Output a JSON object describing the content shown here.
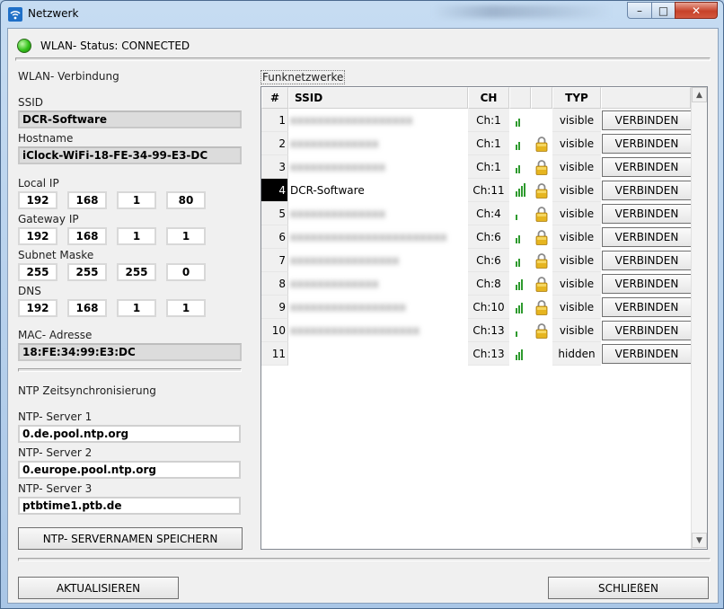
{
  "window": {
    "title": "Netzwerk",
    "background_text": ""
  },
  "status": {
    "text": "WLAN- Status: CONNECTED",
    "led_color": "#33c21a"
  },
  "wlan": {
    "header": "WLAN- Verbindung",
    "ssid_label": "SSID",
    "ssid_value": "DCR-Software",
    "hostname_label": "Hostname",
    "hostname_value": "iClock-WiFi-18-FE-34-99-E3-DC",
    "local_ip_label": "Local IP",
    "local_ip": [
      "192",
      "168",
      "1",
      "80"
    ],
    "gateway_label": "Gateway IP",
    "gateway_ip": [
      "192",
      "168",
      "1",
      "1"
    ],
    "subnet_label": "Subnet Maske",
    "subnet": [
      "255",
      "255",
      "255",
      "0"
    ],
    "dns_label": "DNS",
    "dns": [
      "192",
      "168",
      "1",
      "1"
    ],
    "mac_label": "MAC- Adresse",
    "mac_value": "18:FE:34:99:E3:DC"
  },
  "ntp": {
    "header": "NTP Zeitsynchronisierung",
    "server1_label": "NTP- Server 1",
    "server1_value": "0.de.pool.ntp.org",
    "server2_label": "NTP- Server 2",
    "server2_value": "0.europe.pool.ntp.org",
    "server3_label": "NTP- Server 3",
    "server3_value": "ptbtime1.ptb.de",
    "save_label": "NTP- SERVERNAMEN SPEICHERN"
  },
  "networks": {
    "group_label": "Funknetzwerke",
    "columns": {
      "num": "#",
      "ssid": "SSID",
      "ch": "CH",
      "typ": "TYP"
    },
    "connect_label": "VERBINDEN",
    "rows": [
      {
        "num": "1",
        "ssid": "xxxxxxxxxxxxxxxxxx",
        "blurred": true,
        "ch": "Ch:1",
        "signal": 2,
        "locked": false,
        "typ": "visible",
        "selected": false
      },
      {
        "num": "2",
        "ssid": "xxxxxxxxxxxxx",
        "blurred": true,
        "ch": "Ch:1",
        "signal": 2,
        "locked": true,
        "typ": "visible",
        "selected": false
      },
      {
        "num": "3",
        "ssid": "xxxxxxxxxxxxxx",
        "blurred": true,
        "ch": "Ch:1",
        "signal": 2,
        "locked": true,
        "typ": "visible",
        "selected": false
      },
      {
        "num": "4",
        "ssid": "DCR-Software",
        "blurred": false,
        "ch": "Ch:11",
        "signal": 4,
        "locked": true,
        "typ": "visible",
        "selected": true
      },
      {
        "num": "5",
        "ssid": "xxxxxxxxxxxxxx",
        "blurred": true,
        "ch": "Ch:4",
        "signal": 1,
        "locked": true,
        "typ": "visible",
        "selected": false
      },
      {
        "num": "6",
        "ssid": "xxxxxxxxxxxxxxxxxxxxxxx",
        "blurred": true,
        "ch": "Ch:6",
        "signal": 2,
        "locked": true,
        "typ": "visible",
        "selected": false
      },
      {
        "num": "7",
        "ssid": "xxxxxxxxxxxxxxxx",
        "blurred": true,
        "ch": "Ch:6",
        "signal": 2,
        "locked": true,
        "typ": "visible",
        "selected": false
      },
      {
        "num": "8",
        "ssid": "xxxxxxxxxxxxx",
        "blurred": true,
        "ch": "Ch:8",
        "signal": 3,
        "locked": true,
        "typ": "visible",
        "selected": false
      },
      {
        "num": "9",
        "ssid": "xxxxxxxxxxxxxxxxx",
        "blurred": true,
        "ch": "Ch:10",
        "signal": 3,
        "locked": true,
        "typ": "visible",
        "selected": false
      },
      {
        "num": "10",
        "ssid": "xxxxxxxxxxxxxxxxxxx",
        "blurred": true,
        "ch": "Ch:13",
        "signal": 1,
        "locked": true,
        "typ": "visible",
        "selected": false
      },
      {
        "num": "11",
        "ssid": "",
        "blurred": false,
        "ch": "Ch:13",
        "signal": 3,
        "locked": false,
        "typ": "hidden",
        "selected": false
      }
    ]
  },
  "footer": {
    "refresh_label": "AKTUALISIEREN",
    "close_label": "SCHLIEßEN"
  }
}
